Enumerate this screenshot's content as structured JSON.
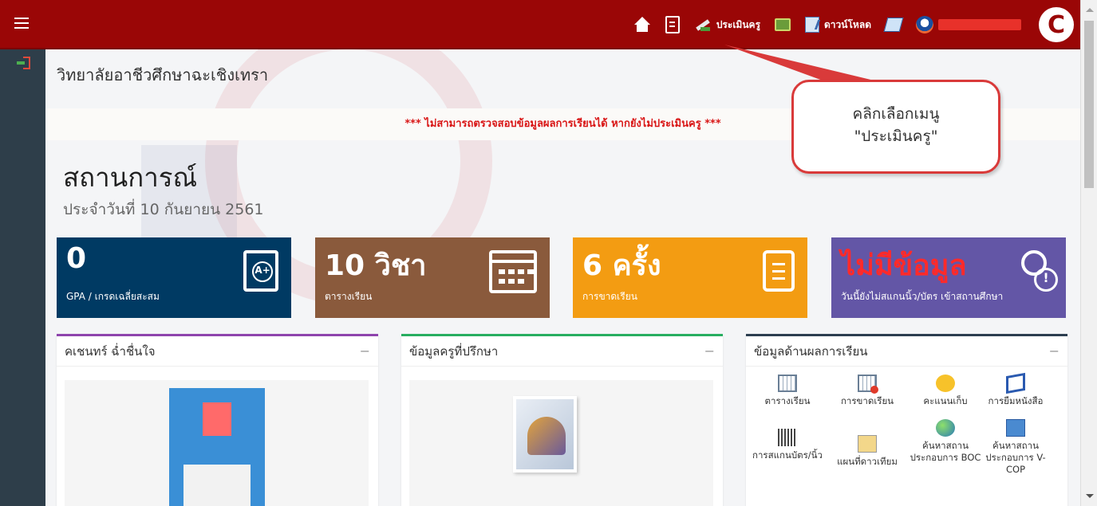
{
  "nav": {
    "evaluate_label": "ประเมินครู",
    "download_label": "ดาวน์โหลด",
    "logo_letter": "C"
  },
  "main": {
    "school_name": "วิทยาลัยอาชีวศึกษาฉะเชิงเทรา",
    "warning": "*** ไม่สามารถตรวจสอบข้อมูลผลการเรียนได้ หากยังไม่ประเมินครู ***",
    "title": "สถานการณ์",
    "date": "ประจำวันที่ 10 กันยายน 2561"
  },
  "stats": [
    {
      "value": "0",
      "caption": "GPA / เกรดเฉลี่ยสะสม",
      "color": "#003a63"
    },
    {
      "value": "10 วิชา",
      "caption": "ตารางเรียน",
      "color": "#8a5a3c"
    },
    {
      "value": "6 ครั้ง",
      "caption": "การขาดเรียน",
      "color": "#f39c12"
    },
    {
      "value": "ไม่มีข้อมูล",
      "caption": "วันนี้ยังไม่สแกนนิ้ว/บัตร เข้าสถานศึกษา",
      "color": "#6356a6"
    }
  ],
  "panels": {
    "student_title": "คเชนทร์ ฉ่ำชื่นใจ",
    "advisor_title": "ข้อมูลครูที่ปรึกษา",
    "results_title": "ข้อมูลด้านผลการเรียน",
    "minimize": "−"
  },
  "results_menu": [
    {
      "label": "ตารางเรียน",
      "icon": "calendar-icon"
    },
    {
      "label": "การขาดเรียน",
      "icon": "calendar-absent-icon"
    },
    {
      "label": "คะแนนเก็บ",
      "icon": "smiley-icon"
    },
    {
      "label": "การยืมหนังสือ",
      "icon": "book-icon"
    },
    {
      "label": "การสแกนบัตร/นิ้ว",
      "icon": "barcode-icon"
    },
    {
      "label": "แผนที่ดาวเทียม",
      "icon": "map-icon"
    },
    {
      "label": "ค้นหาสถานประกอบการ BOC",
      "icon": "globe-icon"
    },
    {
      "label": "ค้นหาสถานประกอบการ V-COP",
      "icon": "building-icon"
    }
  ],
  "annotation": {
    "line1": "คลิกเลือกเมนู",
    "line2": "\"ประเมินครู\"",
    "color": "#d93a3a"
  }
}
